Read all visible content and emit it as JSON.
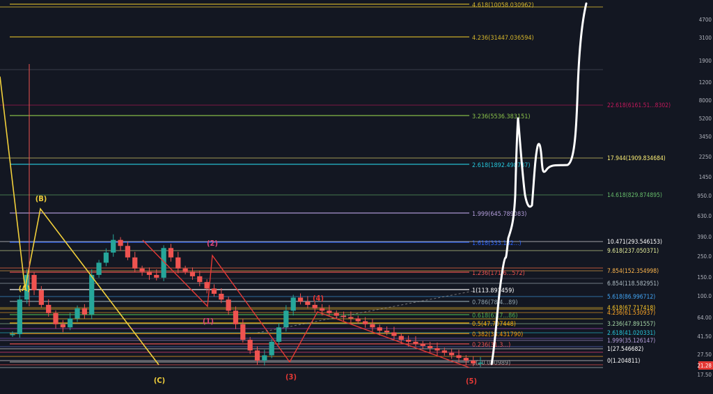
{
  "chart_data": {
    "type": "line",
    "scale": "log",
    "ylim": [
      17.5,
      6000
    ],
    "grid": false,
    "price_axis": {
      "ticks": [
        "4700",
        "3100",
        "1900",
        "1200",
        "8000",
        "5200",
        "3450",
        "2250",
        "1450",
        "950.0",
        "630.0",
        "390.0",
        "250.0",
        "150.0",
        "100.0",
        "64.00",
        "41.50",
        "27.50",
        "17.50"
      ],
      "last_price": "21.28",
      "last_price_color": "#e53935"
    },
    "fib_levels": [
      {
        "label": "4.618(10058.030962)",
        "color": "#d4b52b"
      },
      {
        "label": "4.236(31447.036594)",
        "color": "#d4b52b"
      },
      {
        "label": "3.236(5536.383151)",
        "color": "#8bc34a"
      },
      {
        "label": "2.618(1892.498787)",
        "color": "#26c6da"
      },
      {
        "label": "1.999(645.789083)",
        "color": "#b39ddb"
      },
      {
        "label": "1.618(333.182...)",
        "color": "#2962ff"
      },
      {
        "label": "1.236(171.6...572)",
        "color": "#ef5350"
      },
      {
        "label": "1(113.891459)",
        "color": "#ffffff"
      },
      {
        "label": "0.786(78.4...89)",
        "color": "#90a4ae"
      },
      {
        "label": "0.618(63.7...86)",
        "color": "#4caf50"
      },
      {
        "label": "0.5(47.707448)",
        "color": "#ffb300"
      },
      {
        "label": "0.382(38.431790)",
        "color": "#ff9800"
      },
      {
        "label": "0.236(31.3...)",
        "color": "#ef5350"
      },
      {
        "label": "0(20.090989)",
        "color": "#9e9e9e"
      }
    ],
    "right_fib_levels": [
      {
        "label": "22.618(6161.51...8302)",
        "color": "#c2185b"
      },
      {
        "label": "17.944(1909.834684)",
        "color": "#fff176"
      },
      {
        "label": "14.618(829.874895)",
        "color": "#66bb6a"
      },
      {
        "label": "10.471(293.546153)",
        "color": "#ffffff"
      },
      {
        "label": "9.618(237.050371)",
        "color": "#e6ee9c"
      },
      {
        "label": "7.854(152.354998)",
        "color": "#ffb74d"
      },
      {
        "label": "6.854(118.582951)",
        "color": "#b0bec5"
      },
      {
        "label": "5.618(86.996712)",
        "color": "#42a5f5"
      },
      {
        "label": "4.618(67.717418)",
        "color": "#ffca28"
      },
      {
        "label": "4.236(61.530937)",
        "color": "#ffa726"
      },
      {
        "label": "3.236(47.891557)",
        "color": "#a5d6a7"
      },
      {
        "label": "2.618(41.020331)",
        "color": "#26c6da"
      },
      {
        "label": "1.999(35.126147)",
        "color": "#b39ddb"
      },
      {
        "label": "1(27.546682)",
        "color": "#ffffff"
      },
      {
        "label": "0(1.204811)",
        "color": "#ffffff"
      }
    ],
    "wave_labels": [
      {
        "text": "(B)",
        "color": "#f2d03b"
      },
      {
        "text": "(A)",
        "color": "#f2d03b"
      },
      {
        "text": "(C)",
        "color": "#f2d03b"
      },
      {
        "text": "(2)",
        "color": "#e0457b"
      },
      {
        "text": "(1)",
        "color": "#e0457b"
      },
      {
        "text": "(3)",
        "color": "#e53935"
      },
      {
        "text": "(4)",
        "color": "#e53935"
      },
      {
        "text": "(5)",
        "color": "#e53935"
      }
    ],
    "series": [
      {
        "type": "candles",
        "values": [
          34,
          60,
          90,
          70,
          55,
          48,
          40,
          38,
          44,
          52,
          47,
          90,
          110,
          130,
          160,
          145,
          120,
          100,
          95,
          90,
          86,
          140,
          120,
          100,
          95,
          88,
          80,
          72,
          66,
          60,
          50,
          40,
          31,
          26,
          22,
          24,
          30,
          38,
          50,
          62,
          58,
          55,
          52,
          50,
          48,
          46,
          45,
          44,
          42,
          40,
          38,
          36,
          35,
          33,
          31,
          30,
          29,
          28,
          27,
          26,
          25,
          24,
          23,
          22,
          21,
          21.28
        ]
      },
      {
        "type": "projection",
        "values": [
          21,
          60,
          260,
          900,
          5200,
          1300,
          4000,
          2000,
          2500,
          6000
        ]
      }
    ]
  }
}
